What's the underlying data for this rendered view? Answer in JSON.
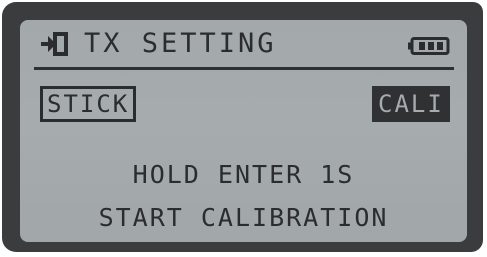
{
  "screen": {
    "title": "TX SETTING",
    "icons": {
      "back": "back-arrow-icon",
      "battery": "battery-icon"
    },
    "battery_level": 1.0
  },
  "menu": {
    "stick_label": "STICK",
    "cali_label": "CALI"
  },
  "message": {
    "line1": "HOLD ENTER 1S",
    "line2": "START CALIBRATION"
  },
  "colors": {
    "lcd_background": "#a6acae",
    "lcd_ink": "#2a2c2e",
    "bezel": "#3a3c3e"
  }
}
